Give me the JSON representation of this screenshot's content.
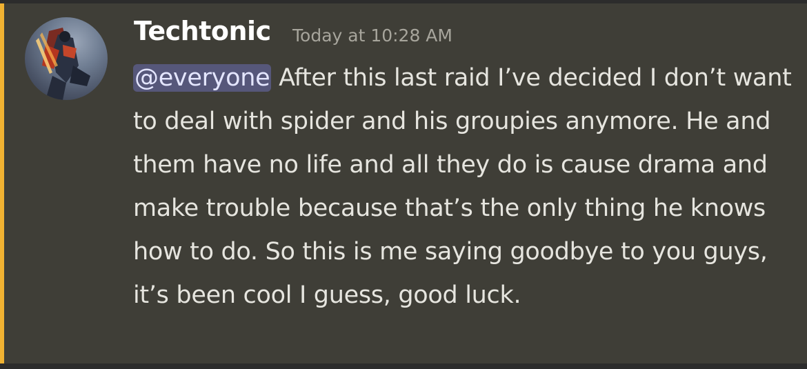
{
  "message": {
    "author": "Techtonic",
    "timestamp": "Today at 10:28 AM",
    "mention": "@everyone",
    "content": " After this last raid I’ve decided I don’t want to deal with spider and his groupies anymore. He and them have no life and all they do is cause drama and make trouble because that’s the only thing he knows how to do. So this is me saying goodbye to you guys, it’s been cool I guess, good luck.",
    "avatar_icon": "superhero-avatar-icon"
  },
  "colors": {
    "mention_bar": "#f0b232",
    "mention_bg": "#56577a",
    "background": "#3f3e37",
    "author": "#ffffff",
    "text": "#e6e5df",
    "timestamp": "#a7a59c"
  }
}
